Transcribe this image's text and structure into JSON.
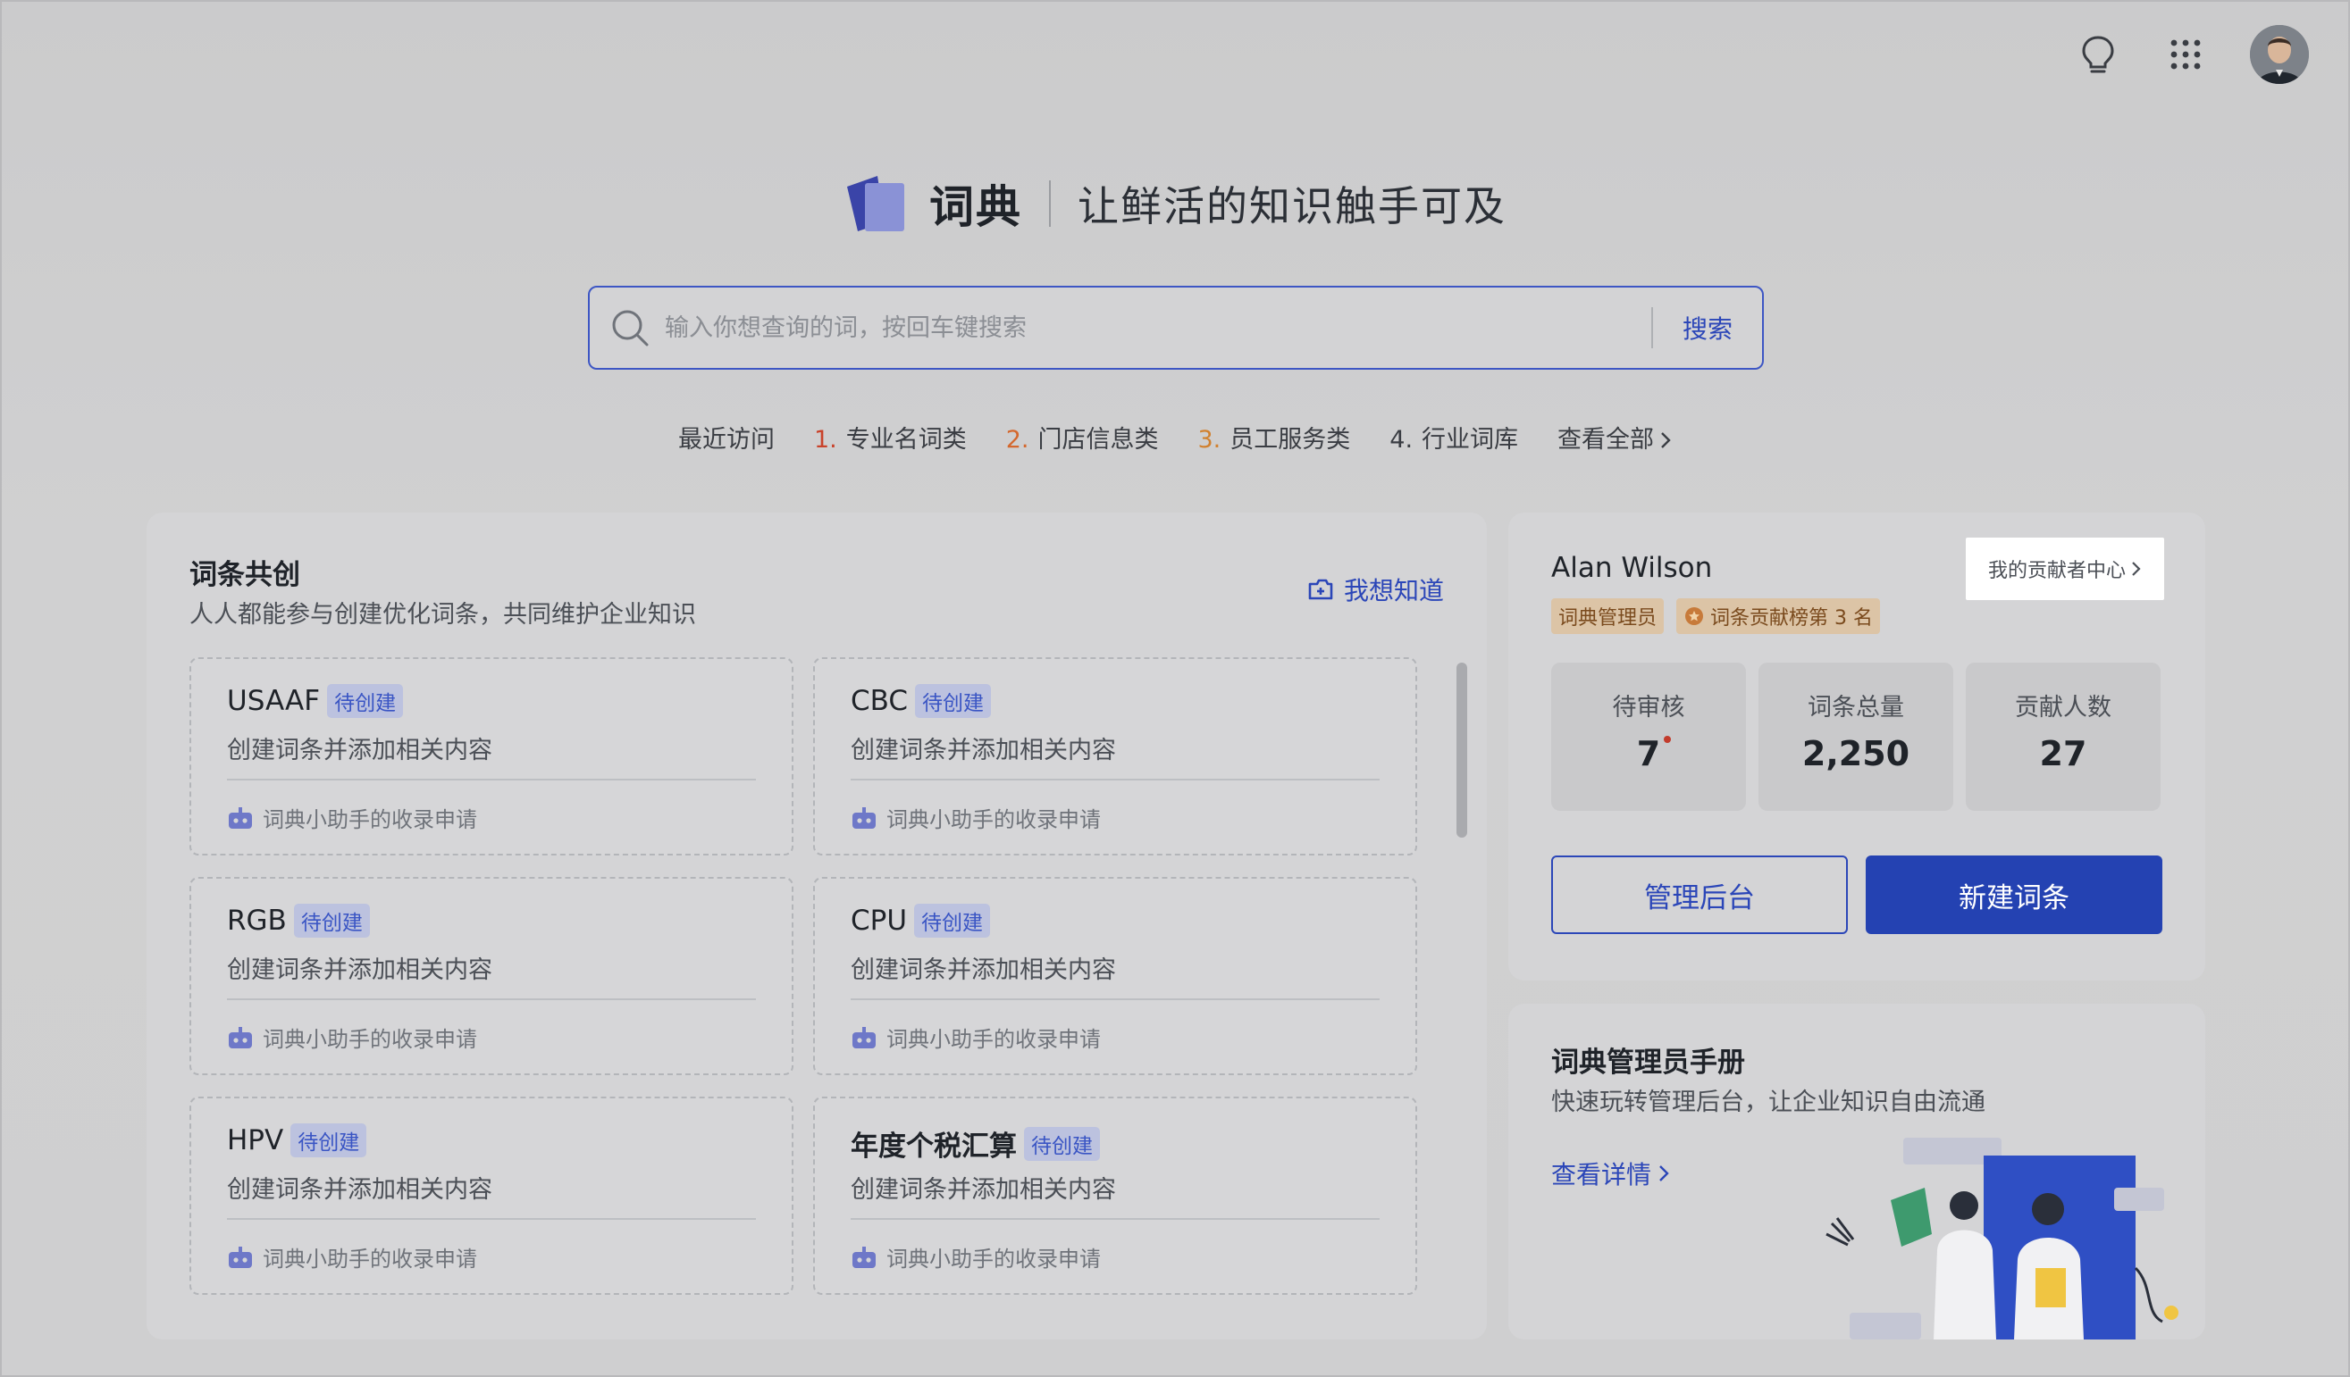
{
  "topbar": {
    "icons": [
      "lightbulb-icon",
      "apps-grid-icon"
    ],
    "avatar_alt": "user-avatar"
  },
  "hero": {
    "brand": "词典",
    "slogan": "让鲜活的知识触手可及"
  },
  "search": {
    "placeholder": "输入你想查询的词，按回车键搜索",
    "value": "",
    "button_label": "搜索"
  },
  "recent": {
    "label": "最近访问",
    "items": [
      {
        "num": "1.",
        "text": "专业名词类"
      },
      {
        "num": "2.",
        "text": "门店信息类"
      },
      {
        "num": "3.",
        "text": "员工服务类"
      },
      {
        "num": "4.",
        "text": "行业词库"
      }
    ],
    "view_all": "查看全部"
  },
  "cocreate": {
    "title": "词条共创",
    "subtitle": "人人都能参与创建优化词条，共同维护企业知识",
    "want_label": "我想知道",
    "cards": [
      {
        "term": "USAAF",
        "tag": "待创建",
        "desc": "创建词条并添加相关内容",
        "foot": "词典小助手的收录申请"
      },
      {
        "term": "CBC",
        "tag": "待创建",
        "desc": "创建词条并添加相关内容",
        "foot": "词典小助手的收录申请"
      },
      {
        "term": "RGB",
        "tag": "待创建",
        "desc": "创建词条并添加相关内容",
        "foot": "词典小助手的收录申请"
      },
      {
        "term": "CPU",
        "tag": "待创建",
        "desc": "创建词条并添加相关内容",
        "foot": "词典小助手的收录申请"
      },
      {
        "term": "HPV",
        "tag": "待创建",
        "desc": "创建词条并添加相关内容",
        "foot": "词典小助手的收录申请"
      },
      {
        "term": "年度个税汇算",
        "tag": "待创建",
        "desc": "创建词条并添加相关内容",
        "foot": "词典小助手的收录申请"
      }
    ]
  },
  "user": {
    "name": "Alan Wilson",
    "contributor_center": "我的贡献者中心",
    "badges": [
      "词典管理员",
      "词条贡献榜第 3 名"
    ],
    "stats": [
      {
        "label": "待审核",
        "value": "7"
      },
      {
        "label": "词条总量",
        "value": "2,250"
      },
      {
        "label": "贡献人数",
        "value": "27"
      }
    ],
    "admin_button": "管理后台",
    "new_button": "新建词条"
  },
  "manual": {
    "title": "词典管理员手册",
    "subtitle": "快速玩转管理后台，让企业知识自由流通",
    "link": "查看详情"
  },
  "colors": {
    "accent": "#2442b2",
    "danger": "#c23b2c",
    "tag_bg": "#bcc2df"
  }
}
